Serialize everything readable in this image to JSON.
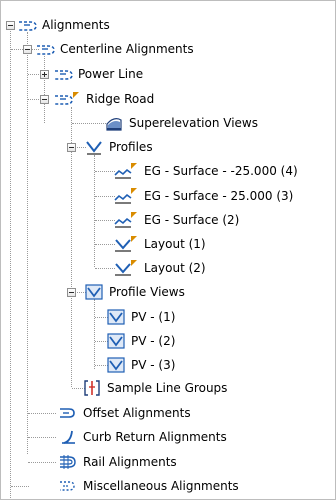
{
  "tree": {
    "alignments": {
      "label": "Alignments",
      "icon": "alignment-icon"
    },
    "centerline": {
      "label": "Centerline Alignments",
      "icon": "alignment-icon"
    },
    "power_line": {
      "label": "Power Line",
      "icon": "alignment-icon"
    },
    "ridge_road": {
      "label": "Ridge Road",
      "icon": "alignment-icon"
    },
    "superelevation": {
      "label": "Superelevation Views",
      "icon": "superelevation-view-icon"
    },
    "profiles": {
      "label": "Profiles",
      "icon": "profile-icon"
    },
    "profile_items": [
      {
        "label": "EG - Surface - -25.000 (4)",
        "icon": "surface-profile-icon"
      },
      {
        "label": "EG - Surface - 25.000 (3)",
        "icon": "surface-profile-icon"
      },
      {
        "label": "EG - Surface (2)",
        "icon": "surface-profile-icon"
      },
      {
        "label": "Layout (1)",
        "icon": "layout-profile-icon"
      },
      {
        "label": "Layout (2)",
        "icon": "layout-profile-icon"
      }
    ],
    "profile_views": {
      "label": "Profile Views",
      "icon": "profile-view-icon"
    },
    "pv_items": [
      {
        "label": "PV - (1)",
        "icon": "profile-view-icon"
      },
      {
        "label": "PV - (2)",
        "icon": "profile-view-icon"
      },
      {
        "label": "PV - (3)",
        "icon": "profile-view-icon"
      }
    ],
    "sample_line_groups": {
      "label": "Sample Line Groups",
      "icon": "sample-line-icon"
    },
    "offset": {
      "label": "Offset Alignments",
      "icon": "offset-alignment-icon"
    },
    "curb_return": {
      "label": "Curb Return Alignments",
      "icon": "curb-return-icon"
    },
    "rail": {
      "label": "Rail Alignments",
      "icon": "rail-alignment-icon"
    },
    "misc": {
      "label": "Miscellaneous Alignments",
      "icon": "misc-alignment-icon"
    }
  },
  "colors": {
    "accent_blue": "#1f5fb4",
    "flag_orange": "#d98c00",
    "connector": "#9a9a9a"
  }
}
